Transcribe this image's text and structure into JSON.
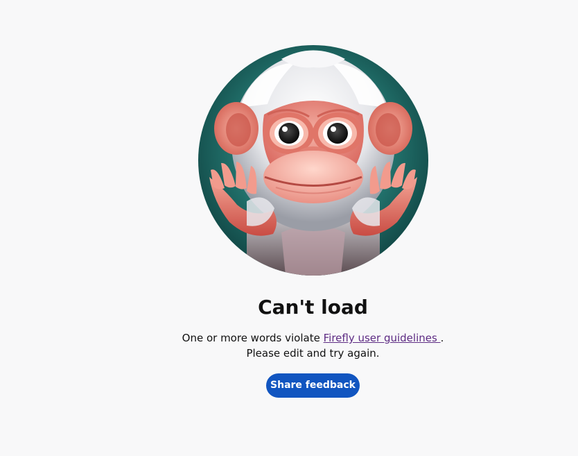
{
  "error": {
    "title": "Can't load",
    "message_prefix": "One or more words violate ",
    "guidelines_link_text": "Firefly user guidelines ",
    "message_suffix": ".",
    "message_line2": "Please edit and try again."
  },
  "actions": {
    "share_feedback_label": "Share feedback"
  },
  "icons": {
    "illustration": "monkey-shrug-illustration"
  },
  "colors": {
    "background": "#f8f8f9",
    "button_bg": "#1155c0",
    "button_text": "#ffffff",
    "link": "#5d2b83",
    "title": "#111111"
  }
}
